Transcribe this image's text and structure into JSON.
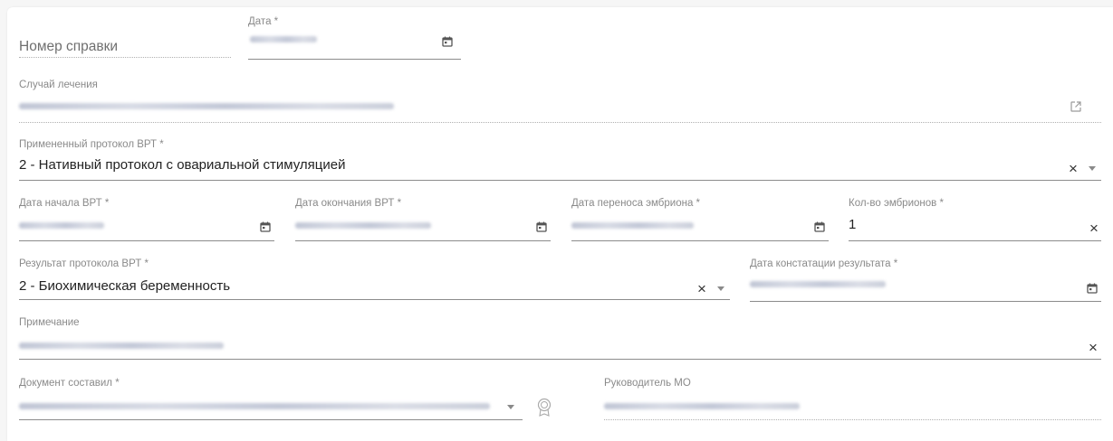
{
  "form": {
    "number": {
      "placeholder": "Номер справки"
    },
    "date": {
      "label": "Дата *"
    },
    "treatment_case": {
      "label": "Случай лечения"
    },
    "protocol": {
      "label": "Примененный протокол ВРТ *",
      "value": "2 - Нативный протокол с овариальной стимуляцией"
    },
    "vrt_start": {
      "label": "Дата начала ВРТ *"
    },
    "vrt_end": {
      "label": "Дата окончания ВРТ *"
    },
    "transfer_date": {
      "label": "Дата переноса эмбриона *"
    },
    "embryo_count": {
      "label": "Кол-во эмбрионов *",
      "value": "1"
    },
    "result": {
      "label": "Результат протокола ВРТ *",
      "value": "2 - Биохимическая беременность"
    },
    "result_date": {
      "label": "Дата констатации результата *"
    },
    "note": {
      "label": "Примечание"
    },
    "author": {
      "label": "Документ составил *"
    },
    "head": {
      "label": "Руководитель МО"
    }
  },
  "icons": {
    "calendar": "calendar-icon",
    "external": "external-link-icon",
    "clear": "×",
    "dropdown": "chevron-down-icon",
    "signature": "signature-badge-icon"
  },
  "colors": {
    "underline": "#8c8c8c",
    "label": "#8a8a8a",
    "text": "#222222"
  }
}
